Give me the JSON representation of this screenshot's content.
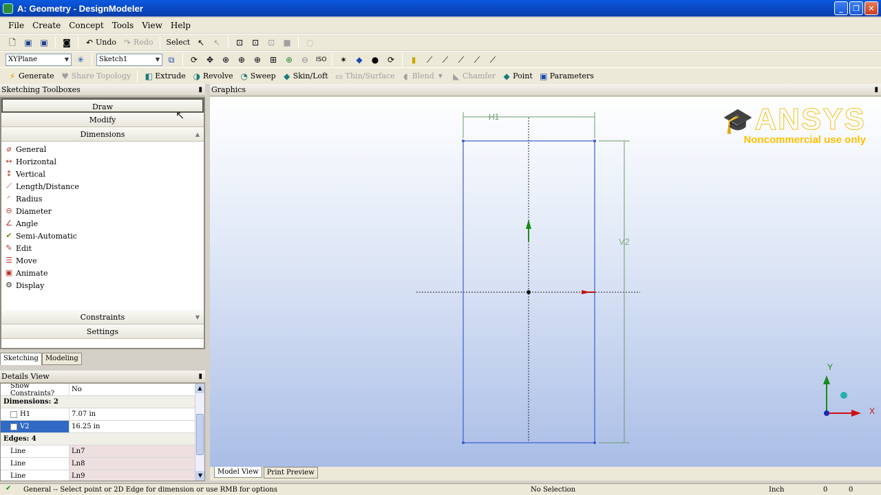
{
  "window": {
    "title": "A: Geometry - DesignModeler",
    "buttons": [
      "_",
      "❐",
      "✕"
    ]
  },
  "menu": [
    "File",
    "Create",
    "Concept",
    "Tools",
    "View",
    "Help"
  ],
  "toolbar1": {
    "undo": "Undo",
    "redo": "Redo",
    "select": "Select"
  },
  "toolbar2": {
    "plane": "XYPlane",
    "sketch": "Sketch1"
  },
  "toolbar3": {
    "generate": "Generate",
    "share_topology": "Share Topology",
    "extrude": "Extrude",
    "revolve": "Revolve",
    "sweep": "Sweep",
    "skin_loft": "Skin/Loft",
    "thin_surface": "Thin/Surface",
    "blend": "Blend",
    "chamfer": "Chamfer",
    "point": "Point",
    "parameters": "Parameters"
  },
  "toolbox": {
    "header": "Sketching Toolboxes",
    "draw": "Draw",
    "modify": "Modify",
    "dimensions": "Dimensions",
    "constraints": "Constraints",
    "settings": "Settings",
    "items": [
      "General",
      "Horizontal",
      "Vertical",
      "Length/Distance",
      "Radius",
      "Diameter",
      "Angle",
      "Semi-Automatic",
      "Edit",
      "Move",
      "Animate",
      "Display"
    ]
  },
  "tabs": {
    "sketching": "Sketching",
    "modeling": "Modeling"
  },
  "details": {
    "header": "Details View",
    "show_constraints": {
      "label": "Show Constraints?",
      "value": "No"
    },
    "dimensions_group": "Dimensions: 2",
    "h1": {
      "label": "H1",
      "value": "7.07 in"
    },
    "v2": {
      "label": "V2",
      "value": "16.25 in"
    },
    "edges_group": "Edges: 4",
    "lines": [
      {
        "label": "Line",
        "value": "Ln7"
      },
      {
        "label": "Line",
        "value": "Ln8"
      },
      {
        "label": "Line",
        "value": "Ln9"
      }
    ]
  },
  "graphics": {
    "header": "Graphics",
    "logo": "ANSYS",
    "noncommercial": "Noncommercial use only",
    "dim_h": "H1",
    "dim_v": "V2",
    "axis_x": "X",
    "axis_y": "Y"
  },
  "view_tabs": {
    "model_view": "Model View",
    "print_preview": "Print Preview"
  },
  "status": {
    "message": "General -- Select point or 2D Edge for dimension or use RMB for options",
    "selection": "No Selection",
    "units": "Inch",
    "v1": "0",
    "v2": "0"
  }
}
